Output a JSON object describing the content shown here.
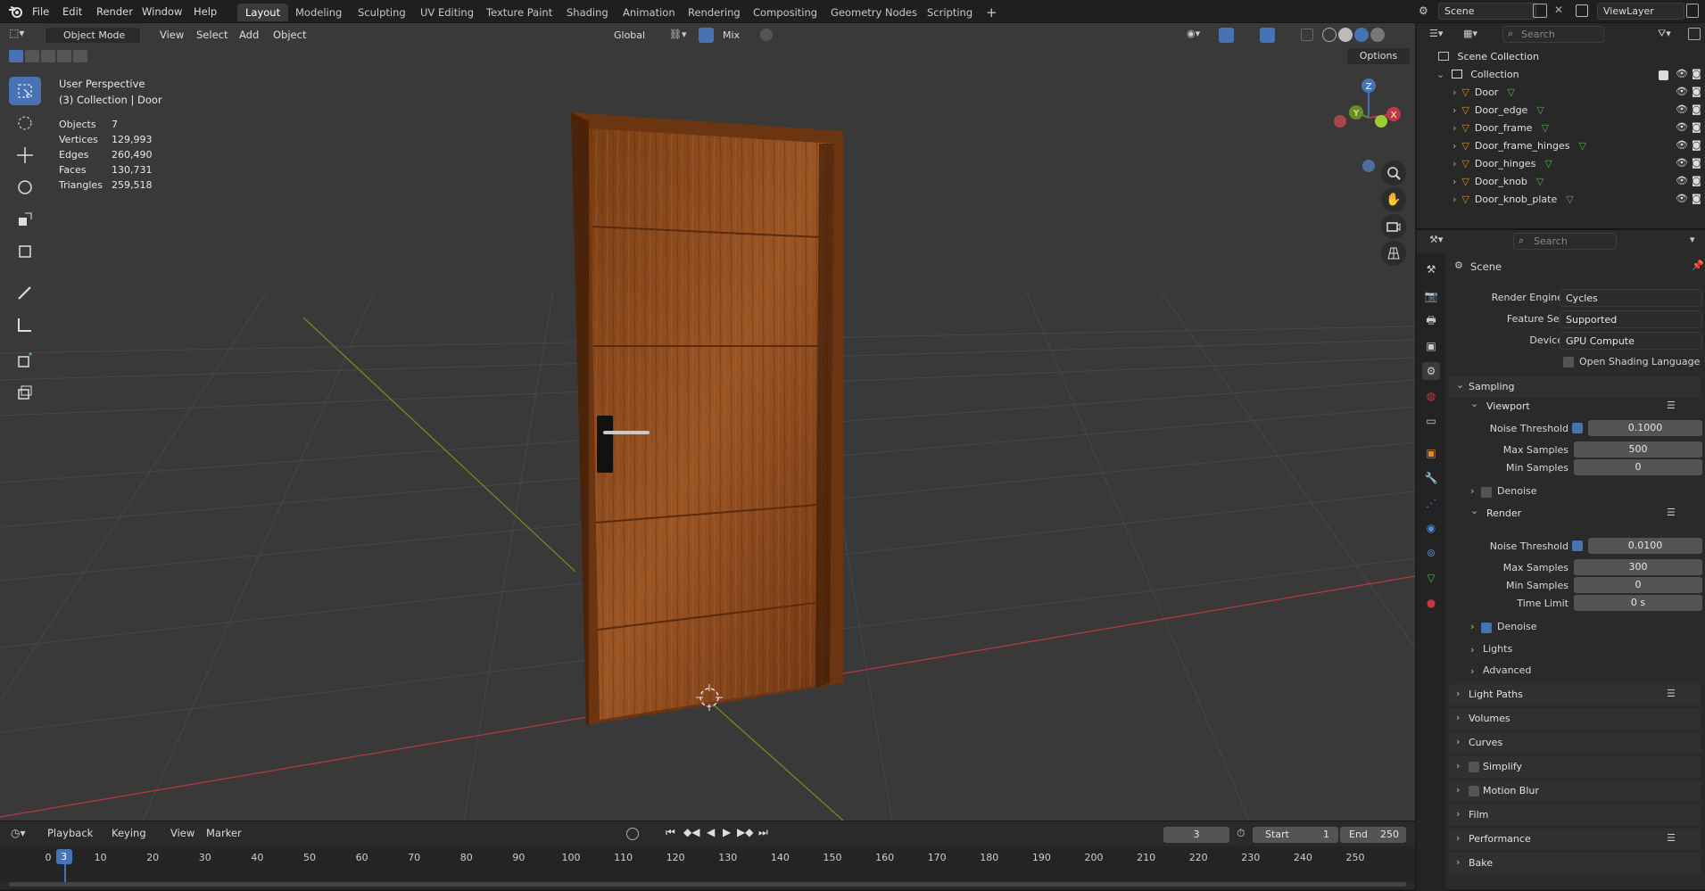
{
  "topbar": {
    "menus": [
      "File",
      "Edit",
      "Render",
      "Window",
      "Help"
    ],
    "workspaces": [
      "Layout",
      "Modeling",
      "Sculpting",
      "UV Editing",
      "Texture Paint",
      "Shading",
      "Animation",
      "Rendering",
      "Compositing",
      "Geometry Nodes",
      "Scripting"
    ],
    "active_workspace": "Layout",
    "add_tab": "+",
    "scene": "Scene",
    "view_layer": "ViewLayer"
  },
  "viewport": {
    "mode": "Object Mode",
    "menus": [
      "View",
      "Select",
      "Add",
      "Object"
    ],
    "orientation": "Global",
    "snap": "Mix",
    "options": "Options",
    "overlay_title": "User Perspective",
    "overlay_subtitle": "(3) Collection | Door",
    "stats": [
      {
        "label": "Objects",
        "value": "7"
      },
      {
        "label": "Vertices",
        "value": "129,993"
      },
      {
        "label": "Edges",
        "value": "260,490"
      },
      {
        "label": "Faces",
        "value": "130,731"
      },
      {
        "label": "Triangles",
        "value": "259,518"
      }
    ],
    "gizmo": {
      "z": "Z",
      "y": "Y",
      "x": "X"
    },
    "colors": {
      "background": "#393939",
      "x_axis": "#c0393f",
      "y_axis": "#6b8e23",
      "door": "#8a4a1e",
      "selection": "#4772b3"
    }
  },
  "tools": [
    "select-box-icon",
    "cursor-icon",
    "move-icon",
    "rotate-icon",
    "scale-icon",
    "transform-icon",
    "annotate-icon",
    "measure-icon",
    "add-cube-icon",
    "extrude-icon"
  ],
  "timeline": {
    "menus": [
      "Playback",
      "Keying",
      "View",
      "Marker"
    ],
    "current_frame": "3",
    "start_label": "Start",
    "start": "1",
    "end_label": "End",
    "end": "250",
    "ticks": [
      "0",
      "10",
      "20",
      "30",
      "40",
      "50",
      "60",
      "70",
      "80",
      "90",
      "100",
      "110",
      "120",
      "130",
      "140",
      "150",
      "160",
      "170",
      "180",
      "190",
      "200",
      "210",
      "220",
      "230",
      "240",
      "250"
    ]
  },
  "outliner": {
    "search_placeholder": "Search",
    "scene_collection": "Scene Collection",
    "collection": "Collection",
    "items": [
      "Door",
      "Door_edge",
      "Door_frame",
      "Door_frame_hinges",
      "Door_hinges",
      "Door_knob",
      "Door_knob_plate"
    ]
  },
  "properties": {
    "search_placeholder": "Search",
    "context": "Scene",
    "render_engine_label": "Render Engine",
    "render_engine": "Cycles",
    "feature_set_label": "Feature Set",
    "feature_set": "Supported",
    "device_label": "Device",
    "device": "GPU Compute",
    "osl": "Open Shading Language",
    "sampling": "Sampling",
    "viewport": "Viewport",
    "noise_threshold_label": "Noise Threshold",
    "vp_noise": "0.1000",
    "max_samples_label": "Max Samples",
    "vp_max": "500",
    "min_samples_label": "Min Samples",
    "vp_min": "0",
    "denoise": "Denoise",
    "render": "Render",
    "r_noise": "0.0100",
    "r_max": "300",
    "r_min": "0",
    "time_limit_label": "Time Limit",
    "time_limit": "0 s",
    "lights": "Lights",
    "advanced": "Advanced",
    "panels": [
      "Light Paths",
      "Volumes",
      "Curves",
      "Simplify",
      "Motion Blur",
      "Film",
      "Performance",
      "Bake"
    ]
  }
}
